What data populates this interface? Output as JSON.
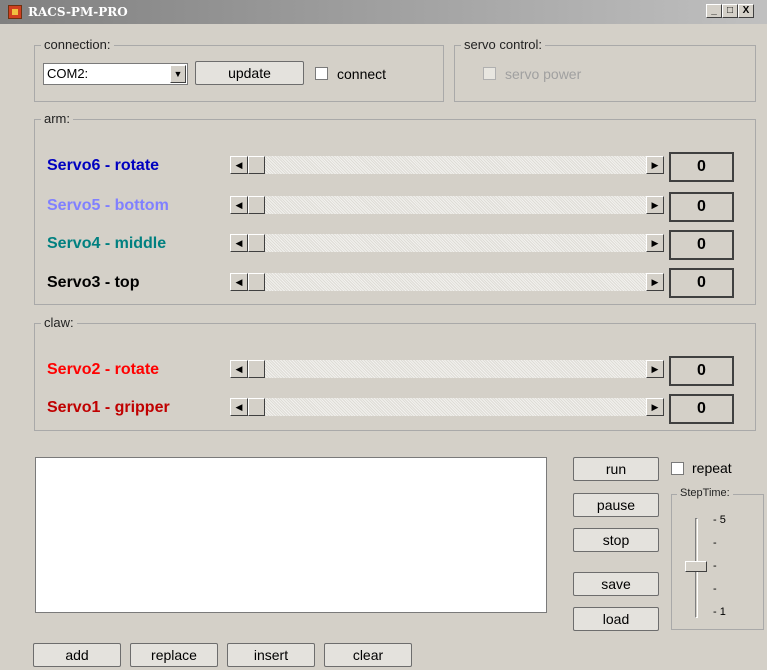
{
  "window": {
    "title": "RACS-PM-PRO",
    "controls": [
      "_",
      "□",
      "X"
    ]
  },
  "connection": {
    "label": "connection:",
    "port": "COM2:",
    "update_label": "update",
    "connect_label": "connect"
  },
  "servo_control": {
    "label": "servo control:",
    "power_label": "servo power"
  },
  "arm": {
    "label": "arm:",
    "servos": [
      {
        "name": "Servo6 - rotate",
        "value": "0",
        "color": "#0000c0"
      },
      {
        "name": "Servo5 - bottom",
        "value": "0",
        "color": "#8080ff"
      },
      {
        "name": "Servo4 - middle",
        "value": "0",
        "color": "#008080"
      },
      {
        "name": "Servo3 - top",
        "value": "0",
        "color": "#000000"
      }
    ]
  },
  "claw": {
    "label": "claw:",
    "servos": [
      {
        "name": "Servo2 - rotate",
        "value": "0",
        "color": "#ff0000"
      },
      {
        "name": "Servo1 - gripper",
        "value": "0",
        "color": "#c00000"
      }
    ]
  },
  "sequence": {
    "run": "run",
    "repeat": "repeat",
    "pause": "pause",
    "stop": "stop",
    "save": "save",
    "load": "load",
    "add": "add",
    "replace": "replace",
    "insert": "insert",
    "clear": "clear"
  },
  "step_time": {
    "label": "StepTime:",
    "ticks": [
      "- 5",
      "-",
      "-",
      "-",
      "- 1"
    ],
    "value": 3,
    "min": 1,
    "max": 5
  }
}
